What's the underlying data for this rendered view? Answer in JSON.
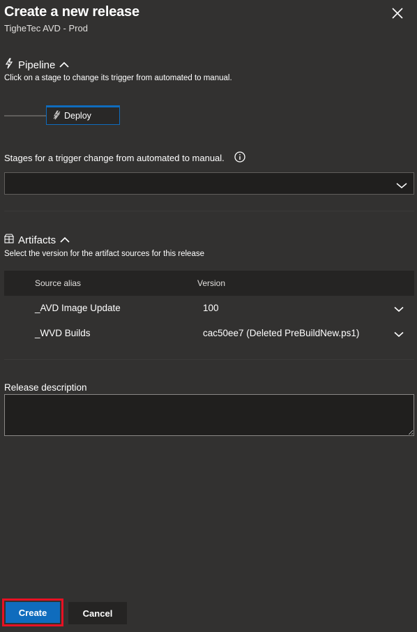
{
  "header": {
    "title": "Create a new release",
    "subtitle": "TigheTec AVD - Prod"
  },
  "pipeline": {
    "heading": "Pipeline",
    "description": "Click on a stage to change its trigger from automated to manual.",
    "stage_label": "Deploy"
  },
  "trigger": {
    "label": "Stages for a trigger change from automated to manual.",
    "selected": ""
  },
  "artifacts": {
    "heading": "Artifacts",
    "description": "Select the version for the artifact sources for this release",
    "columns": [
      "Source alias",
      "Version"
    ],
    "rows": [
      {
        "alias": "_AVD Image Update",
        "version": "100"
      },
      {
        "alias": "_WVD Builds",
        "version": "cac50ee7 (Deleted PreBuildNew.ps1)"
      }
    ]
  },
  "release_description": {
    "label": "Release description",
    "value": ""
  },
  "footer": {
    "create_label": "Create",
    "cancel_label": "Cancel"
  },
  "colors": {
    "accent": "#0f6cbd",
    "highlight_outline": "#e81123",
    "background": "#323130"
  },
  "icons": [
    "close-icon",
    "lightning-icon",
    "chevron-up-icon",
    "info-icon",
    "chevron-down-icon",
    "artifact-box-icon"
  ]
}
